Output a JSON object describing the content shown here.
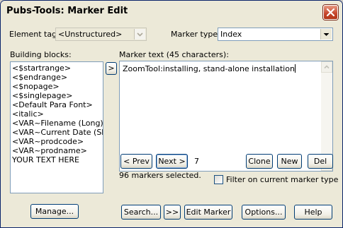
{
  "window": {
    "title": "Pubs-Tools: Marker Edit"
  },
  "element_tag": {
    "label": "Element tag:",
    "value": "<Unstructured>"
  },
  "marker_type": {
    "label": "Marker type:",
    "value": "Index"
  },
  "building_blocks": {
    "label": "Building blocks:",
    "items": [
      "<$startrange>",
      "<$endrange>",
      "<$nopage>",
      "<$singlepage>",
      "<Default Para Font>",
      "<italic>",
      "<VAR~Filename (Long)>",
      "<VAR~Current Date (Short)>",
      "<VAR~prodcode>",
      "<VAR~prodname>",
      "YOUR TEXT HERE"
    ]
  },
  "insert_button": {
    "label": ">"
  },
  "marker_text": {
    "label": "Marker text (45 characters):",
    "value": "ZoomTool:installing, stand-alone installation"
  },
  "navigation": {
    "prev_label": "< Prev",
    "next_label": "Next >",
    "index": "7"
  },
  "actions": {
    "clone_label": "Clone",
    "new_label": "New",
    "delete_label": "Del"
  },
  "status": {
    "selected": "96 markers selected."
  },
  "filter": {
    "label": "Filter on current marker type",
    "checked": false
  },
  "footer": {
    "manage_label": "Manage...",
    "search_label": "Search...",
    "search_next_label": ">>",
    "edit_marker_label": "Edit Marker",
    "options_label": "Options...",
    "help_label": "Help"
  }
}
